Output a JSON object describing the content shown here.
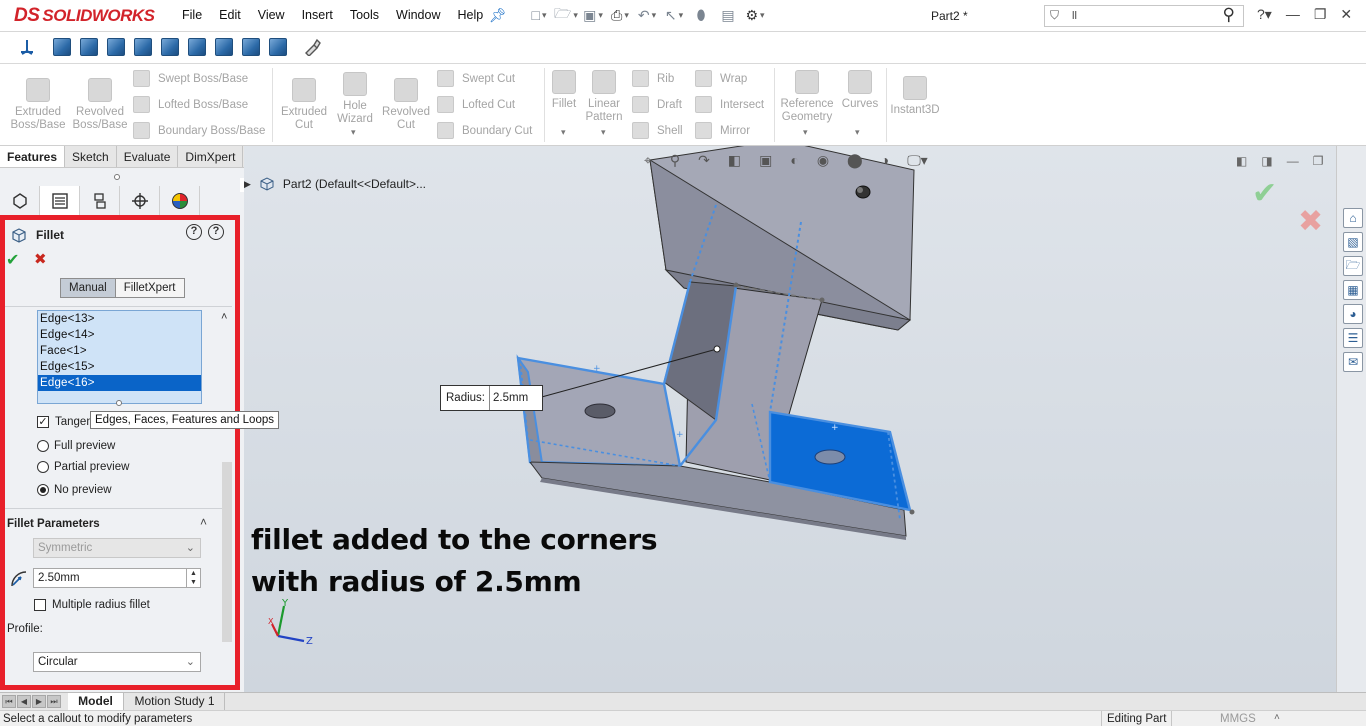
{
  "app": {
    "logo_ds": "DS",
    "logo_text": "SOLIDWORKS",
    "doc_title": "Part2 *",
    "accent": "#d2232a"
  },
  "menu": [
    "File",
    "Edit",
    "View",
    "Insert",
    "Tools",
    "Window",
    "Help"
  ],
  "search": {
    "value": "ll"
  },
  "ribbon": {
    "extruded_boss": [
      "Extruded",
      "Boss/Base"
    ],
    "revolved_boss": [
      "Revolved",
      "Boss/Base"
    ],
    "swept_boss": "Swept Boss/Base",
    "lofted_boss": "Lofted Boss/Base",
    "boundary_boss": "Boundary Boss/Base",
    "extruded_cut": [
      "Extruded",
      "Cut"
    ],
    "hole_wizard": [
      "Hole",
      "Wizard"
    ],
    "revolved_cut": [
      "Revolved",
      "Cut"
    ],
    "swept_cut": "Swept Cut",
    "lofted_cut": "Lofted Cut",
    "boundary_cut": "Boundary Cut",
    "fillet": "Fillet",
    "linear_pattern": [
      "Linear",
      "Pattern"
    ],
    "rib": "Rib",
    "draft": "Draft",
    "shell": "Shell",
    "wrap": "Wrap",
    "intersect": "Intersect",
    "mirror": "Mirror",
    "reference_geometry": [
      "Reference",
      "Geometry"
    ],
    "curves": "Curves",
    "instant3d": "Instant3D"
  },
  "cm_tabs": [
    "Features",
    "Sketch",
    "Evaluate",
    "DimXpert"
  ],
  "fillet_pm": {
    "title": "Fillet",
    "help1": "?",
    "help2": "?",
    "mode_manual": "Manual",
    "mode_filletxpert": "FilletXpert",
    "items": [
      "Edge<13>",
      "Edge<14>",
      "Face<1>",
      "Edge<15>",
      "Edge<16>"
    ],
    "selected_index": 4,
    "tangent_label": "Tangent propagation",
    "tangent_checked": true,
    "tooltip": "Edges, Faces, Features and Loops",
    "preview_full": "Full preview",
    "preview_partial": "Partial preview",
    "preview_none": "No preview",
    "params_header": "Fillet Parameters",
    "symmetric": "Symmetric",
    "radius_value": "2.50mm",
    "multiple_radius": "Multiple radius fillet",
    "profile_label": "Profile:",
    "profile_value": "Circular"
  },
  "viewport": {
    "tree_root": "Part2  (Default<<Default>...",
    "callout_label": "Radius:",
    "callout_value": "2.5mm",
    "annotation_line1": "fillet added to the corners",
    "annotation_line2": "with radius of 2.5mm",
    "triad_x": "X",
    "triad_y": "Y",
    "triad_z": "Z"
  },
  "bottom_tabs": {
    "model": "Model",
    "motion": "Motion Study 1"
  },
  "status": {
    "message": "Select a callout to modify parameters",
    "mode": "Editing Part",
    "units": "MMGS"
  }
}
